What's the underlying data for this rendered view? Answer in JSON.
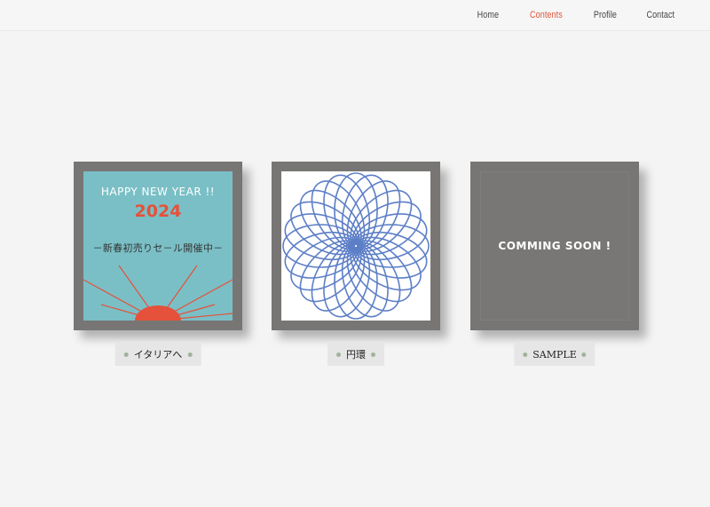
{
  "nav": {
    "items": [
      {
        "label": "Home",
        "active": false
      },
      {
        "label": "Contents",
        "active": true
      },
      {
        "label": "Profile",
        "active": false
      },
      {
        "label": "Contact",
        "active": false
      }
    ],
    "active_color": "#e0553a"
  },
  "cards": [
    {
      "label": "イタリアへ",
      "poster": {
        "headline": "HAPPY NEW YEAR !!",
        "year": "2024",
        "sale_text": "－新春初売りセ－ル開催中－",
        "background_color": "#7abfc6",
        "accent_color": "#e5513a"
      }
    },
    {
      "label": "円環",
      "image": "blue-spirograph-circle",
      "stroke_color": "#5d7fc7"
    },
    {
      "label": "SAMPLE",
      "placeholder_text": "COMMING SOON !"
    }
  ]
}
